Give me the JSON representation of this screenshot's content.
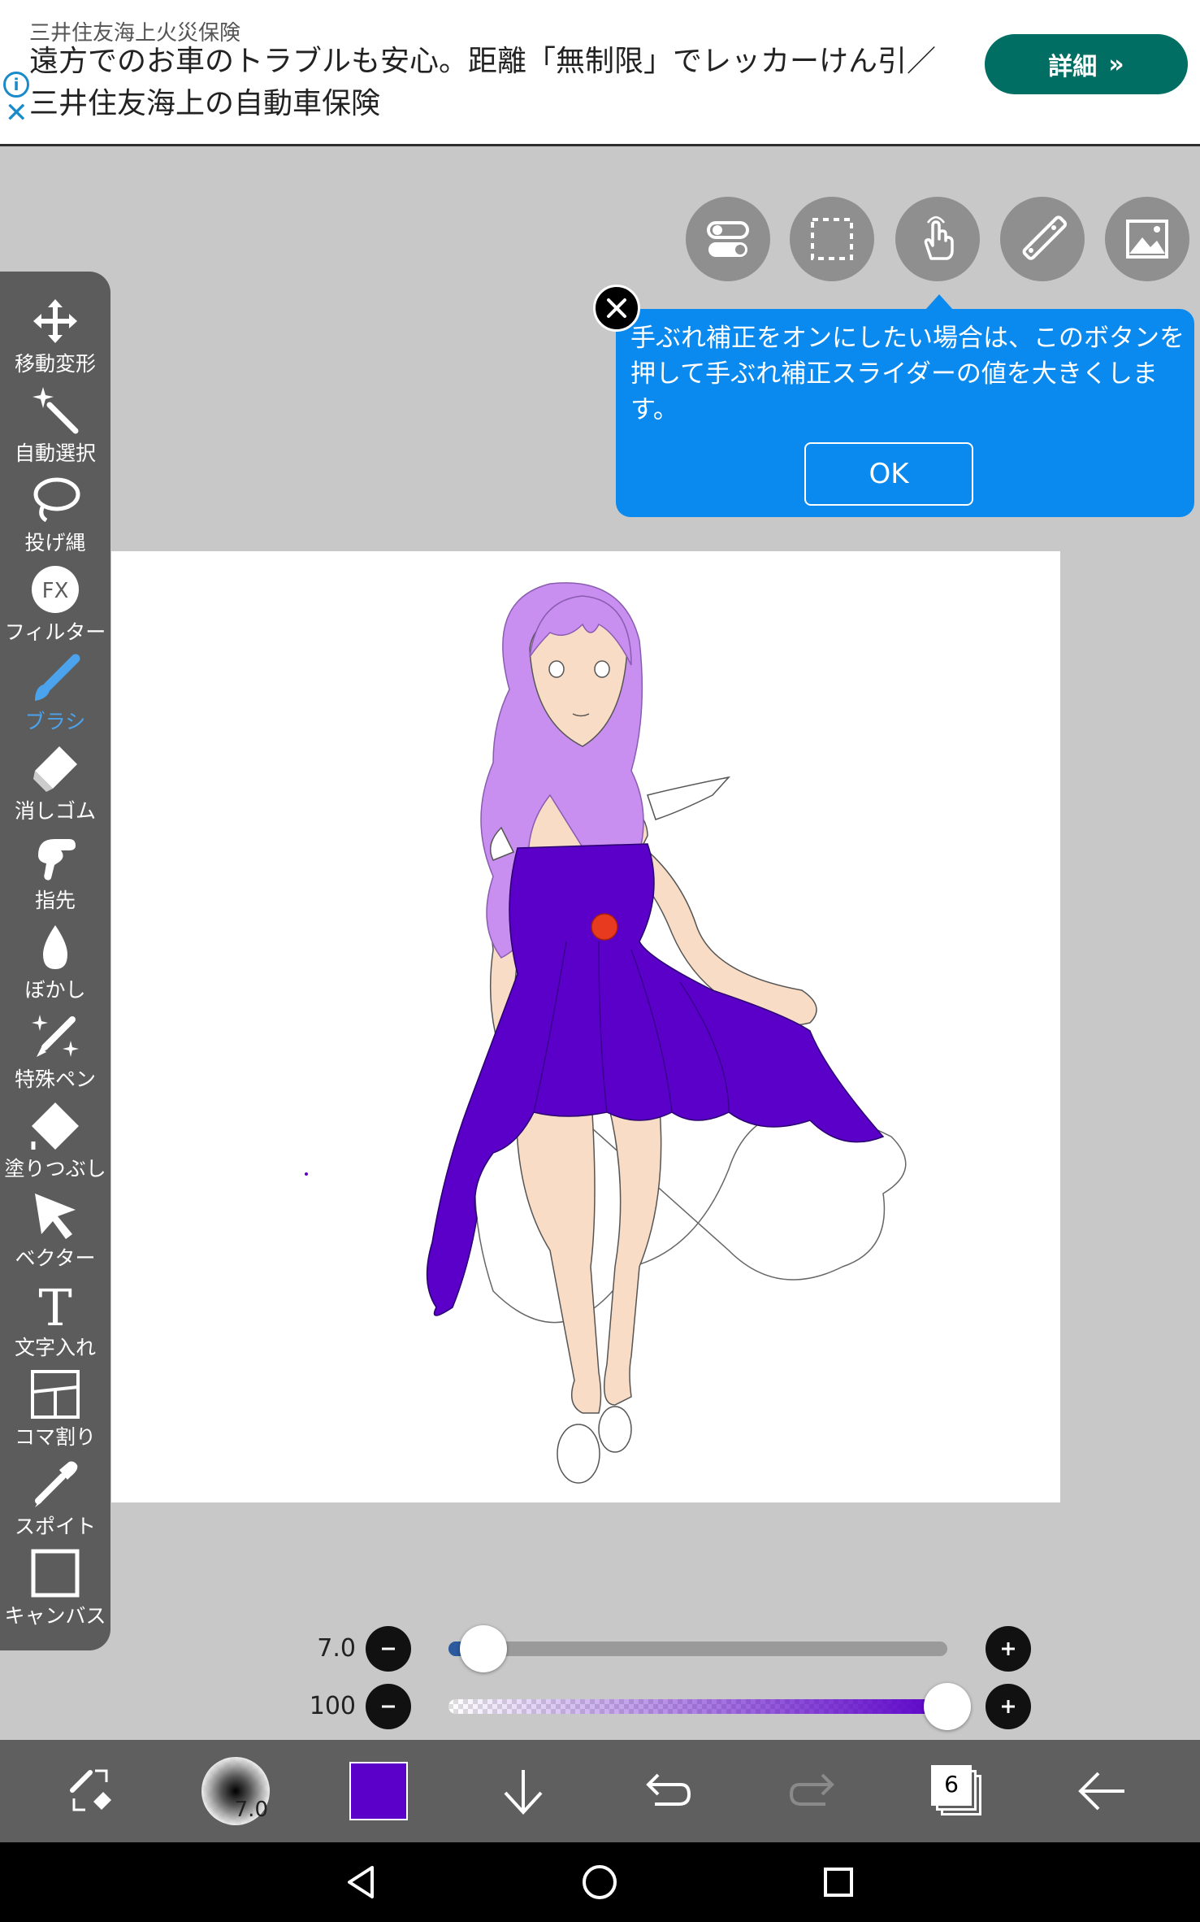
{
  "ad": {
    "sponsor": "三井住友海上火災保険",
    "headline": "遠方でのお車のトラブルも安心。距離「無制限」でレッカーけん引／三井住友海上の自動車保険",
    "cta": "詳細",
    "info_icon": "info-icon",
    "close_icon": "close-icon"
  },
  "top_tools": [
    "stabilizer-toggle-icon",
    "selection-icon",
    "hand-tool-icon",
    "ruler-icon",
    "material-icon"
  ],
  "tooltip": {
    "message": "手ぶれ補正をオンにしたい場合は、このボタンを押して手ぶれ補正スライダーの値を大きくします。",
    "ok": "OK"
  },
  "tools": [
    {
      "label": "移動変形",
      "icon": "move-icon"
    },
    {
      "label": "自動選択",
      "icon": "magic-wand-icon"
    },
    {
      "label": "投げ縄",
      "icon": "lasso-icon"
    },
    {
      "label": "フィルター",
      "icon": "fx-icon"
    },
    {
      "label": "ブラシ",
      "icon": "brush-icon",
      "active": true
    },
    {
      "label": "消しゴム",
      "icon": "eraser-icon"
    },
    {
      "label": "指先",
      "icon": "finger-icon"
    },
    {
      "label": "ぼかし",
      "icon": "blur-icon"
    },
    {
      "label": "特殊ペン",
      "icon": "special-pen-icon"
    },
    {
      "label": "塗りつぶし",
      "icon": "fill-icon"
    },
    {
      "label": "ベクター",
      "icon": "vector-icon"
    },
    {
      "label": "文字入れ",
      "icon": "text-icon"
    },
    {
      "label": "コマ割り",
      "icon": "frame-divider-icon"
    },
    {
      "label": "スポイト",
      "icon": "eyedropper-icon"
    },
    {
      "label": "キャンバス",
      "icon": "canvas-icon"
    }
  ],
  "sliders": {
    "size": {
      "value": "7.0",
      "level": 0.07
    },
    "opacity": {
      "value": "100",
      "level": 1.0
    }
  },
  "bottom": {
    "brush_size_label": "7.0",
    "color": "#5a00c8",
    "layer_count": "6",
    "icons": [
      "swap-tool-icon",
      "brush-preview-icon",
      "color-swatch-icon",
      "save-down-icon",
      "undo-icon",
      "redo-icon",
      "layers-icon",
      "back-icon"
    ]
  },
  "colors": {
    "accent": "#0a8aef",
    "dress": "#5a00c8",
    "hair": "#c88ef0",
    "skin": "#f8dcc6",
    "rose": "#e83a1e",
    "ad_button": "#006e63"
  }
}
